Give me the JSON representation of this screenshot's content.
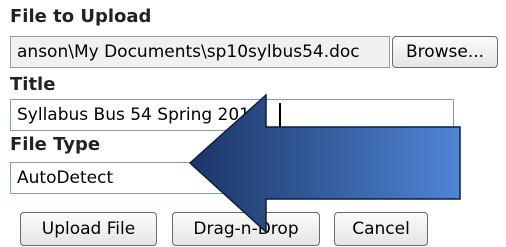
{
  "form": {
    "file_label": "File to Upload",
    "file_path": "anson\\My Documents\\sp10sylbus54.doc",
    "browse_label": "Browse...",
    "title_label": "Title",
    "title_value": "Syllabus Bus 54 Spring 2010",
    "filetype_label": "File Type",
    "filetype_value": "AutoDetect"
  },
  "buttons": {
    "upload_label": "Upload File",
    "dragdrop_label": "Drag-n-Drop",
    "cancel_label": "Cancel"
  },
  "colors": {
    "arrow_dark": "#1c3566",
    "arrow_light": "#4f86d6",
    "field_border": "#7f9db9"
  },
  "icons": {
    "annotation": "left-arrow-icon"
  }
}
